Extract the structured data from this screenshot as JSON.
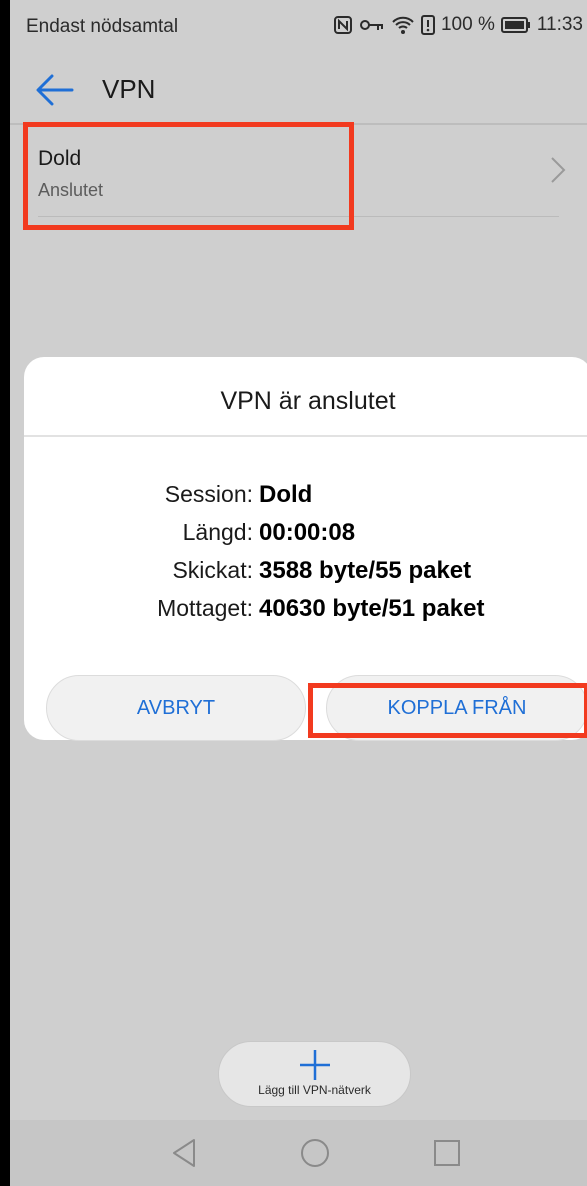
{
  "status_bar": {
    "carrier": "Endast nödsamtal",
    "battery": "100 %",
    "time": "11:33"
  },
  "header": {
    "title": "VPN"
  },
  "vpn_list": [
    {
      "name": "Dold",
      "status": "Anslutet"
    }
  ],
  "dialog": {
    "title": "VPN är anslutet",
    "rows": [
      {
        "label": "Session:",
        "value": "Dold"
      },
      {
        "label": "Längd:",
        "value": "00:00:08"
      },
      {
        "label": "Skickat:",
        "value": "3588 byte/55 paket"
      },
      {
        "label": "Mottaget:",
        "value": "40630 byte/51 paket"
      }
    ],
    "cancel_label": "AVBRYT",
    "disconnect_label": "KOPPLA FRÅN"
  },
  "fab": {
    "label": "Lägg till VPN-nätverk"
  },
  "colors": {
    "accent": "#1f6fd6",
    "highlight": "#f23a1f",
    "dim_background": "#cfcfcf"
  }
}
